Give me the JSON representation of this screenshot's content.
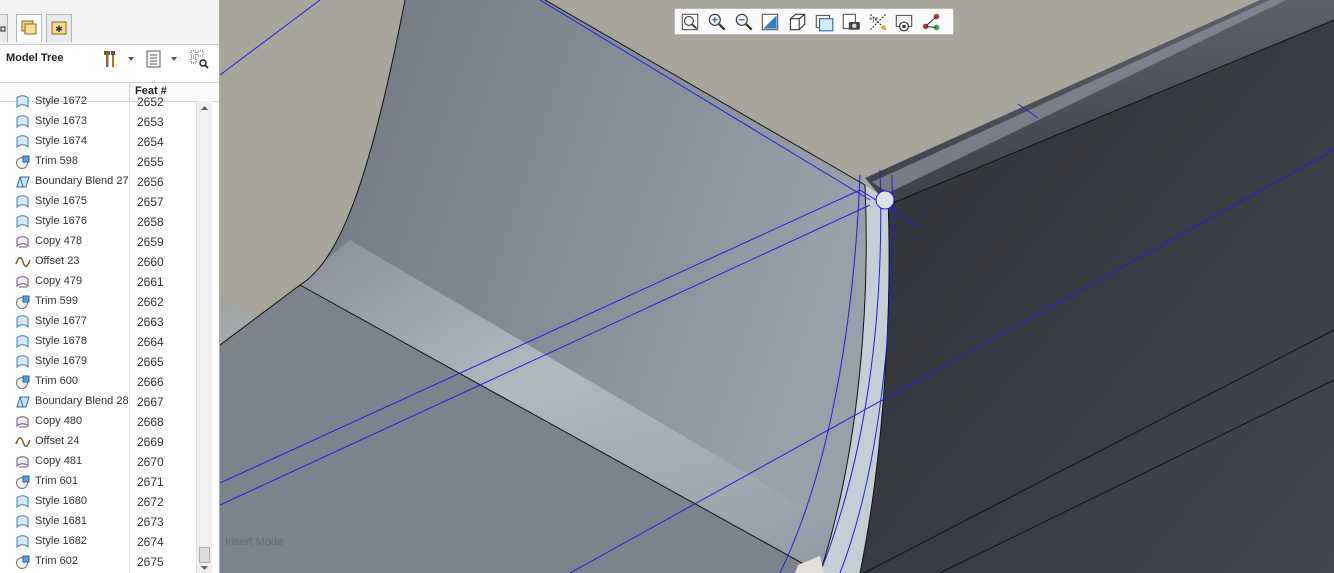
{
  "panel": {
    "title": "Model Tree",
    "column_header": "Feat #"
  },
  "rows": [
    {
      "name": "Style 1672",
      "feat": "2652",
      "icon": "style-icon"
    },
    {
      "name": "Style 1673",
      "feat": "2653",
      "icon": "style-icon"
    },
    {
      "name": "Style 1674",
      "feat": "2654",
      "icon": "style-icon"
    },
    {
      "name": "Trim 598",
      "feat": "2655",
      "icon": "trim-icon"
    },
    {
      "name": "Boundary Blend 27",
      "feat": "2656",
      "icon": "boundary-blend-icon"
    },
    {
      "name": "Style 1675",
      "feat": "2657",
      "icon": "style-icon"
    },
    {
      "name": "Style 1676",
      "feat": "2658",
      "icon": "style-icon"
    },
    {
      "name": "Copy 478",
      "feat": "2659",
      "icon": "copy-icon"
    },
    {
      "name": "Offset 23",
      "feat": "2660",
      "icon": "offset-icon"
    },
    {
      "name": "Copy 479",
      "feat": "2661",
      "icon": "copy-icon"
    },
    {
      "name": "Trim 599",
      "feat": "2662",
      "icon": "trim-icon"
    },
    {
      "name": "Style 1677",
      "feat": "2663",
      "icon": "style-icon"
    },
    {
      "name": "Style 1678",
      "feat": "2664",
      "icon": "style-icon"
    },
    {
      "name": "Style 1679",
      "feat": "2665",
      "icon": "style-icon"
    },
    {
      "name": "Trim 600",
      "feat": "2666",
      "icon": "trim-icon"
    },
    {
      "name": "Boundary Blend 28",
      "feat": "2667",
      "icon": "boundary-blend-icon"
    },
    {
      "name": "Copy 480",
      "feat": "2668",
      "icon": "copy-icon"
    },
    {
      "name": "Offset 24",
      "feat": "2669",
      "icon": "offset-icon"
    },
    {
      "name": "Copy 481",
      "feat": "2670",
      "icon": "copy-icon"
    },
    {
      "name": "Trim 601",
      "feat": "2671",
      "icon": "trim-icon"
    },
    {
      "name": "Style 1680",
      "feat": "2672",
      "icon": "style-icon"
    },
    {
      "name": "Style 1681",
      "feat": "2673",
      "icon": "style-icon"
    },
    {
      "name": "Style 1682",
      "feat": "2674",
      "icon": "style-icon"
    },
    {
      "name": "Trim 602",
      "feat": "2675",
      "icon": "trim-icon"
    }
  ],
  "viewport": {
    "status": "Insert Mode",
    "toolbar_icons": [
      "refit-icon",
      "zoom-in-icon",
      "zoom-out-icon",
      "repaint-icon",
      "display-style-icon",
      "saved-views-icon",
      "view-manager-icon",
      "datum-display-icon",
      "spin-center-icon",
      "annotation-display-icon"
    ]
  },
  "colors": {
    "datum_curve": "#1f1fe0",
    "surface_light": "#8a919b",
    "surface_dark": "#3c3f45",
    "background": "#a8a69c"
  }
}
